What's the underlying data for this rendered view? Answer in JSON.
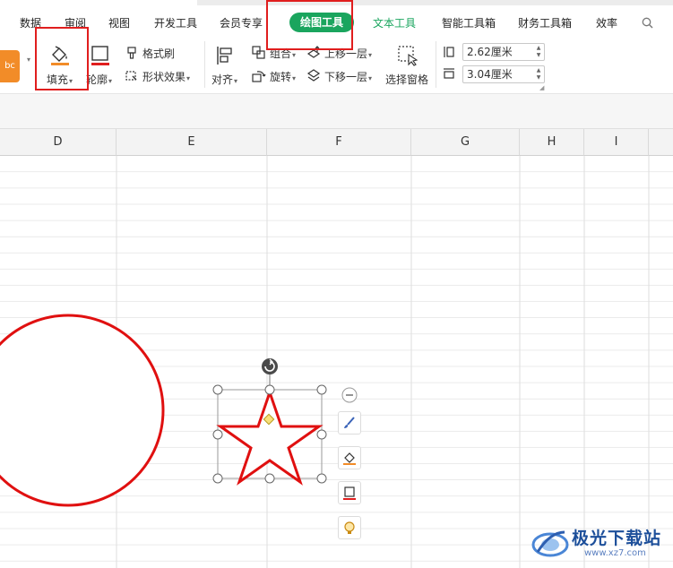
{
  "menu": {
    "tabs": [
      "数据",
      "审阅",
      "视图",
      "开发工具",
      "会员专享"
    ],
    "active_tab": "绘图工具",
    "text_tool_tab": "文本工具",
    "more_tabs": [
      "智能工具箱",
      "财务工具箱",
      "效率"
    ],
    "search_label": "Q"
  },
  "ribbon": {
    "style_sample": "bc",
    "fill_label": "填充",
    "outline_label": "轮廓",
    "format_brush_label": "格式刷",
    "shape_effect_label": "形状效果",
    "align_label": "对齐",
    "group_label": "组合",
    "rotate_label": "旋转",
    "bring_forward_label": "上移一层",
    "send_backward_label": "下移一层",
    "selection_pane_label": "选择窗格",
    "height_value": "2.62厘米",
    "width_value": "3.04厘米"
  },
  "sheet": {
    "columns": [
      "D",
      "E",
      "F",
      "G",
      "H",
      "I"
    ]
  },
  "watermark": {
    "text": "极光下载站",
    "url": "www.xz7.com"
  },
  "colors": {
    "accent": "#1aa55e",
    "highlight": "#e01e1e",
    "shape_stroke": "#e01010",
    "fill_underline": "#f28c28"
  }
}
